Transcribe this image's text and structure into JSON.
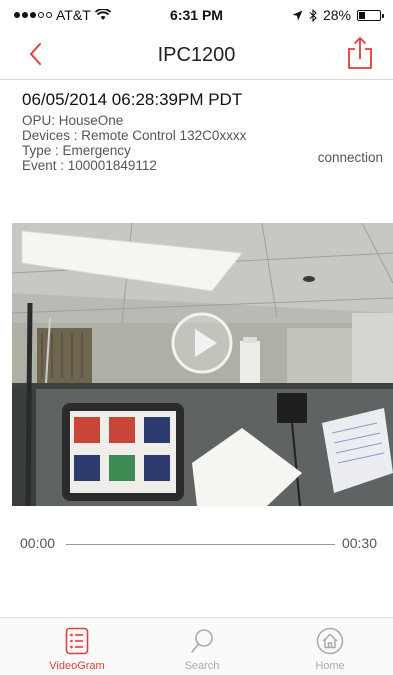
{
  "status": {
    "carrier": "AT&T",
    "time": "6:31 PM",
    "battery_pct": "28%",
    "battery_level": 0.28
  },
  "nav": {
    "title": "IPC1200",
    "back_icon": "chevron-left-icon",
    "share_icon": "share-icon"
  },
  "event": {
    "datetime": "06/05/2014 06:28:39PM PDT",
    "opu": "OPU: HouseOne",
    "devices": "Devices : Remote Control 132C0xxxx",
    "type": "Type : Emergency",
    "event": "Event : 100001849112",
    "connection": "connection"
  },
  "video": {
    "start_time": "00:00",
    "end_time": "00:30",
    "progress": 0
  },
  "tabs": [
    {
      "label": "VideoGram",
      "icon": "list-icon",
      "active": true
    },
    {
      "label": "Search",
      "icon": "search-icon",
      "active": false
    },
    {
      "label": "Home",
      "icon": "home-icon",
      "active": false
    }
  ],
  "colors": {
    "accent": "#e0403a",
    "tab_inactive": "#aaaaaa"
  }
}
